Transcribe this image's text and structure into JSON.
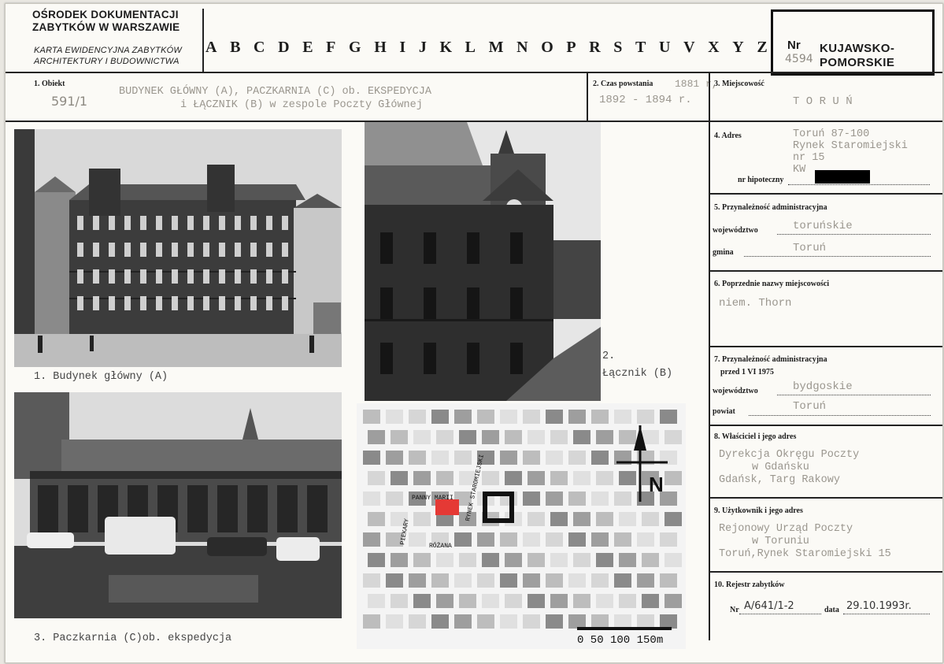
{
  "header": {
    "institution_line1": "OŚRODEK DOKUMENTACJI",
    "institution_line2": "ZABYTKÓW W WARSZAWIE",
    "card_title_line1": "KARTA EWIDENCYJNA ZABYTKÓW",
    "card_title_line2": "ARCHITEKTURY I BUDOWNICTWA",
    "letters": [
      "A",
      "B",
      "C",
      "D",
      "E",
      "F",
      "G",
      "H",
      "I",
      "J",
      "K",
      "L",
      "M",
      "N",
      "O",
      "P",
      "R",
      "S",
      "T",
      "U",
      "V",
      "X",
      "Y",
      "Z"
    ],
    "nr_label": "Nr",
    "nr_handwritten": "4594",
    "region_line1": "KUJAWSKO-",
    "region_line2": "POMORSKIE"
  },
  "fields": {
    "obiekt": {
      "label": "1. Obiekt",
      "handwritten": "591/1",
      "line1": "BUDYNEK GŁÓWNY (A), PACZKARNIA (C) ob. EKSPEDYCJA",
      "line2": "i ŁĄCZNIK (B) w zespole Poczty Głównej"
    },
    "czas": {
      "label": "2. Czas powstania",
      "value1": "1881 r,",
      "value2": "1892 - 1894 r."
    },
    "miejscowosc": {
      "label": "3. Miejscowość",
      "value": "T O R U Ń"
    },
    "adres": {
      "label": "4. Adres",
      "lines": [
        "Toruń  87-100",
        "Rynek Staromiejski",
        "nr 15",
        "KW"
      ],
      "nr_hipoteczny_label": "nr hipoteczny"
    },
    "przynaleznosc": {
      "label": "5. Przynależność administracyjna",
      "wojewodztwo_label": "województwo",
      "wojewodztwo_value": "toruńskie",
      "gmina_label": "gmina",
      "gmina_value": "Toruń"
    },
    "poprzednie": {
      "label": "6. Poprzednie nazwy miejscowości",
      "value": "niem. Thorn"
    },
    "przynaleznosc_przed": {
      "label": "7. Przynależność administracyjna",
      "sublabel": "przed  1 VI 1975",
      "wojewodztwo_label": "województwo",
      "wojewodztwo_value": "bydgoskie",
      "powiat_label": "powiat",
      "powiat_value": "Toruń"
    },
    "wlasciciel": {
      "label": "8. Właściciel i jego adres",
      "lines": [
        "Dyrekcja Okręgu Poczty",
        "w Gdańsku",
        "Gdańsk, Targ Rakowy"
      ]
    },
    "uzytkownik": {
      "label": "9. Użytkownik i jego adres",
      "lines": [
        "Rejonowy Urząd Poczty",
        "w Toruniu",
        "Toruń,Rynek Staromiejski 15"
      ]
    },
    "rejestr": {
      "label": "10. Rejestr zabytków",
      "nr_label": "Nr",
      "nr_value": "A/641/1-2",
      "data_label": "data",
      "data_value": "29.10.1993r."
    }
  },
  "captions": {
    "photo1": "1. Budynek główny (A)",
    "photo2_num": "2.",
    "photo2": "Łącznik (B)",
    "photo3": "3. Paczkarnia (C)ob. ekspedycja"
  },
  "map": {
    "street_labels": [
      "PANNY MARII",
      "RYNEK STAROMIEJSKI",
      "PIEKARY",
      "RÓŻANA"
    ],
    "north": "N",
    "scale": "0  50  100  150m"
  }
}
